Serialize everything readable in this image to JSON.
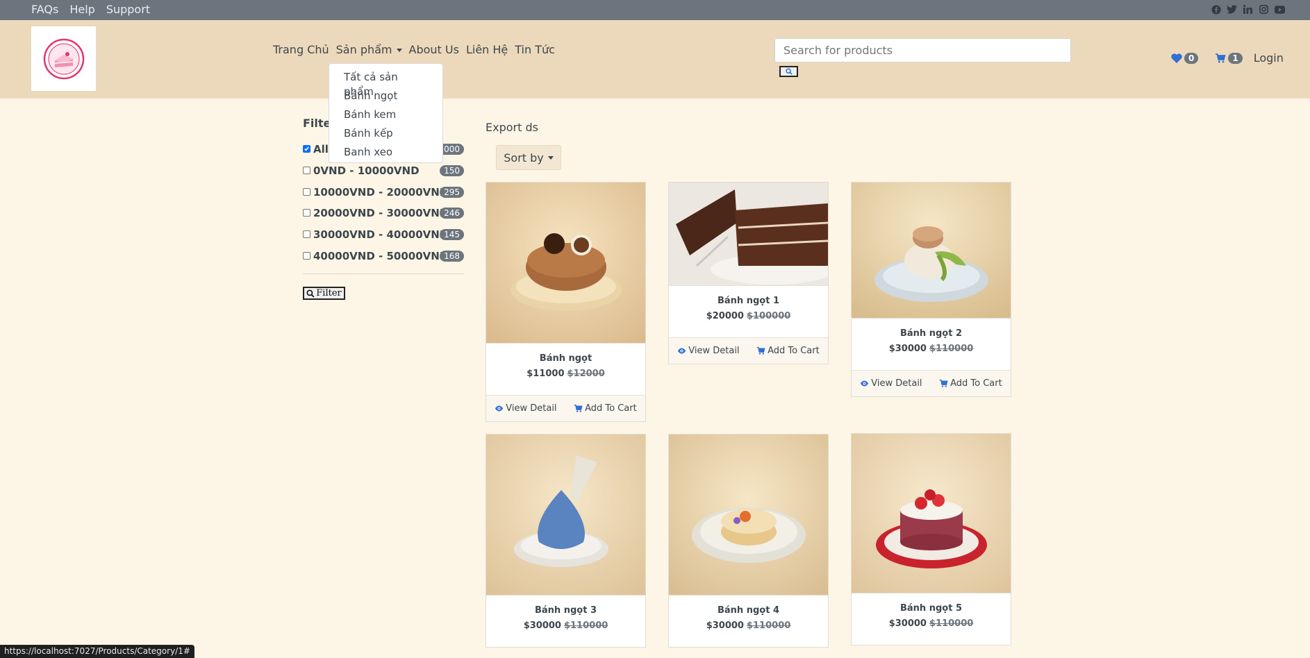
{
  "topbar": {
    "links": [
      "FAQs",
      "Help",
      "Support"
    ],
    "social_icons": [
      "facebook-icon",
      "twitter-icon",
      "linkedin-icon",
      "instagram-icon",
      "youtube-icon"
    ]
  },
  "header": {
    "nav": [
      "Trang Chủ",
      "Sản phẩm",
      "About Us",
      "Liên Hệ",
      "Tin Tức"
    ],
    "search_placeholder": "Search for products",
    "wishlist_count": "0",
    "cart_count": "1",
    "login_label": "Login",
    "accent_color": "#0d6efd"
  },
  "dropdown": {
    "items": [
      "Tất cả sản phẩm",
      "Bánh ngọt",
      "Bánh kem",
      "Bánh kếp",
      "Banh xeo"
    ]
  },
  "filter": {
    "title": "Filter",
    "options": [
      {
        "label": "All",
        "count": "1000",
        "checked": true
      },
      {
        "label": "0VND - 10000VND",
        "count": "150",
        "checked": false
      },
      {
        "label": "10000VND - 20000VND",
        "count": "295",
        "checked": false
      },
      {
        "label": "20000VND - 30000VND",
        "count": "246",
        "checked": false
      },
      {
        "label": "30000VND - 40000VND",
        "count": "145",
        "checked": false
      },
      {
        "label": "40000VND - 50000VND",
        "count": "168",
        "checked": false
      }
    ],
    "button_label": "Filter"
  },
  "products_area": {
    "export_label": "Export ds",
    "sort_label": "Sort by"
  },
  "products": [
    {
      "name": "Bánh ngọt",
      "price": "$11000",
      "old_price": "$12000",
      "view_label": "View Detail",
      "cart_label": "Add To Cart"
    },
    {
      "name": "Bánh ngọt 1",
      "price": "$20000",
      "old_price": "$100000",
      "view_label": "View Detail",
      "cart_label": "Add To Cart"
    },
    {
      "name": "Bánh ngọt 2",
      "price": "$30000",
      "old_price": "$110000",
      "view_label": "View Detail",
      "cart_label": "Add To Cart"
    },
    {
      "name": "Bánh ngọt 3",
      "price": "$30000",
      "old_price": "$110000",
      "view_label": "View Detail",
      "cart_label": "Add To Cart"
    },
    {
      "name": "Bánh ngọt 4",
      "price": "$30000",
      "old_price": "$110000",
      "view_label": "View Detail",
      "cart_label": "Add To Cart"
    },
    {
      "name": "Bánh ngọt 5",
      "price": "$30000",
      "old_price": "$110000",
      "view_label": "View Detail",
      "cart_label": "Add To Cart"
    }
  ],
  "status_url": "https://localhost:7027/Products/Category/1#"
}
